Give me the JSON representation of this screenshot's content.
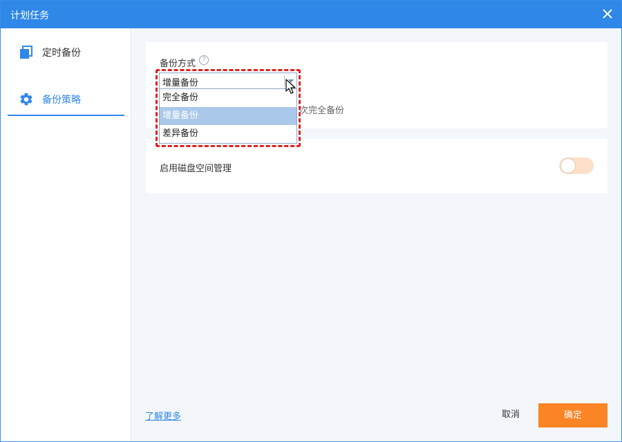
{
  "window": {
    "title": "计划任务"
  },
  "sidebar": {
    "items": [
      {
        "label": "定时备份",
        "icon": "copy-icon",
        "active": false
      },
      {
        "label": "备份策略",
        "icon": "gear-icon",
        "active": true
      }
    ]
  },
  "backup_method": {
    "label": "备份方式",
    "help_icon": "question-icon",
    "selected": "增量备份",
    "options": [
      "完全备份",
      "增量备份",
      "差异备份"
    ],
    "highlighted_option": "增量备份",
    "hint_partial": "次完全备份"
  },
  "disk_space": {
    "label": "启用磁盘空间管理",
    "enabled": false
  },
  "footer": {
    "learn_more": "了解更多",
    "cancel": "取消",
    "confirm": "确定"
  },
  "colors": {
    "titlebar": "#2f87e8",
    "accent": "#2f87e8",
    "confirm_button": "#fb8424",
    "toggle_off": "#fde0c9",
    "highlight_box": "#e02020",
    "option_highlight": "#aac8ea"
  }
}
